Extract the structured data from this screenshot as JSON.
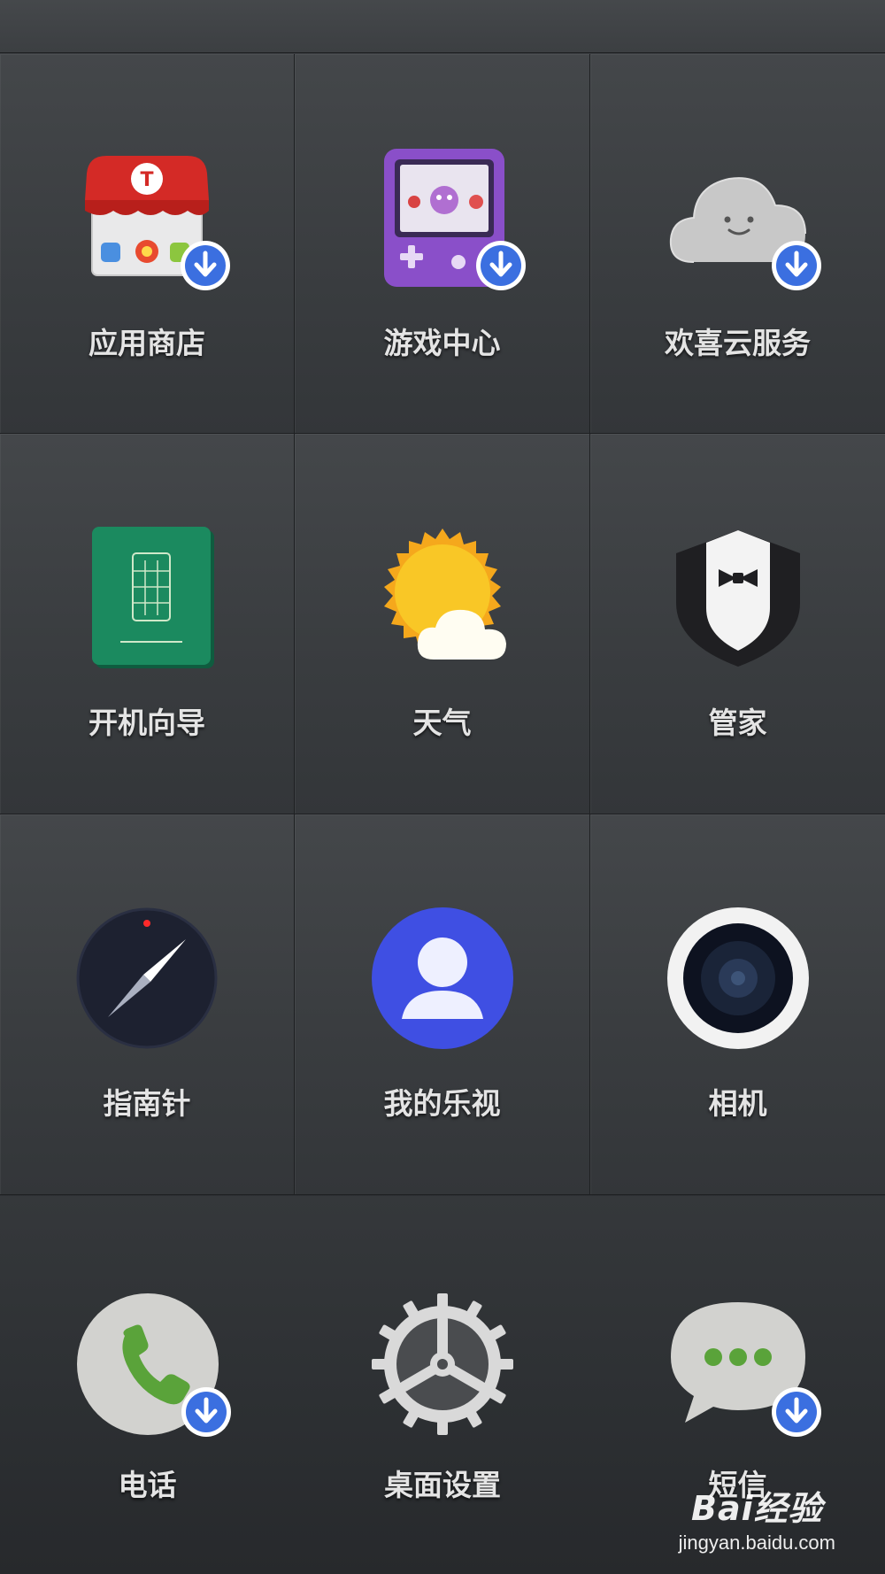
{
  "apps": [
    {
      "label": "应用商店",
      "icon": "app-store-icon",
      "download": true
    },
    {
      "label": "游戏中心",
      "icon": "game-center-icon",
      "download": true
    },
    {
      "label": "欢喜云服务",
      "icon": "cloud-service-icon",
      "download": true
    },
    {
      "label": "开机向导",
      "icon": "setup-guide-icon",
      "download": false
    },
    {
      "label": "天气",
      "icon": "weather-icon",
      "download": false
    },
    {
      "label": "管家",
      "icon": "butler-icon",
      "download": false
    },
    {
      "label": "指南针",
      "icon": "compass-icon",
      "download": false
    },
    {
      "label": "我的乐视",
      "icon": "my-letv-icon",
      "download": false
    },
    {
      "label": "相机",
      "icon": "camera-icon",
      "download": false
    }
  ],
  "dock": [
    {
      "label": "电话",
      "icon": "phone-icon",
      "download": true
    },
    {
      "label": "桌面设置",
      "icon": "gear-icon",
      "download": false
    },
    {
      "label": "短信",
      "icon": "message-icon",
      "download": true
    }
  ],
  "watermark": {
    "brand": "Bai经验",
    "url": "jingyan.baidu.com"
  },
  "colors": {
    "badge_blue": "#3b6fe0",
    "contact_blue": "#3f4fe3"
  }
}
